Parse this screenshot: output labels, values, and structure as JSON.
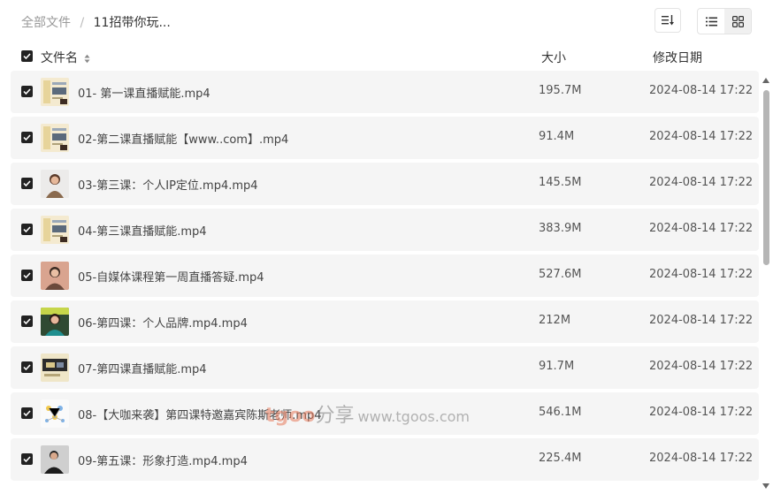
{
  "breadcrumb": {
    "root": "全部文件",
    "separator": "/",
    "current": "11招带你玩..."
  },
  "toolbar": {
    "sort_icon": "sort-icon",
    "list_view_icon": "list-view-icon",
    "grid_view_icon": "grid-view-icon",
    "active_view": "list"
  },
  "table": {
    "headers": {
      "name": "文件名",
      "size": "大小",
      "date": "修改日期"
    },
    "rows": [
      {
        "name": "01- 第一课直播赋能.mp4",
        "size": "195.7M",
        "date": "2024-08-14 17:22",
        "thumb": "slide"
      },
      {
        "name": "02-第二课直播赋能【www..com】.mp4",
        "size": "91.4M",
        "date": "2024-08-14 17:22",
        "thumb": "slide"
      },
      {
        "name": "03-第三课：个人IP定位.mp4.mp4",
        "size": "145.5M",
        "date": "2024-08-14 17:22",
        "thumb": "person-light"
      },
      {
        "name": "04-第三课直播赋能.mp4",
        "size": "383.9M",
        "date": "2024-08-14 17:22",
        "thumb": "slide"
      },
      {
        "name": "05-自媒体课程第一周直播答疑.mp4",
        "size": "527.6M",
        "date": "2024-08-14 17:22",
        "thumb": "person-warm"
      },
      {
        "name": "06-第四课：个人品牌.mp4.mp4",
        "size": "212M",
        "date": "2024-08-14 17:22",
        "thumb": "person-green"
      },
      {
        "name": "07-第四课直播赋能.mp4",
        "size": "91.7M",
        "date": "2024-08-14 17:22",
        "thumb": "slide-dark"
      },
      {
        "name": "08-【大咖来袭】第四课特邀嘉宾陈斯老师.mp4",
        "size": "546.1M",
        "date": "2024-08-14 17:22",
        "thumb": "diagram"
      },
      {
        "name": "09-第五课：形象打造.mp4.mp4",
        "size": "225.4M",
        "date": "2024-08-14 17:22",
        "thumb": "person-dark"
      }
    ]
  },
  "watermark": {
    "brand": "tgoo",
    "text": "分享",
    "url": "www.tgoos.com"
  },
  "colors": {
    "row_bg": "#f5f5f5",
    "checkbox": "#222222",
    "scroll_thumb": "#b5b5b5"
  }
}
